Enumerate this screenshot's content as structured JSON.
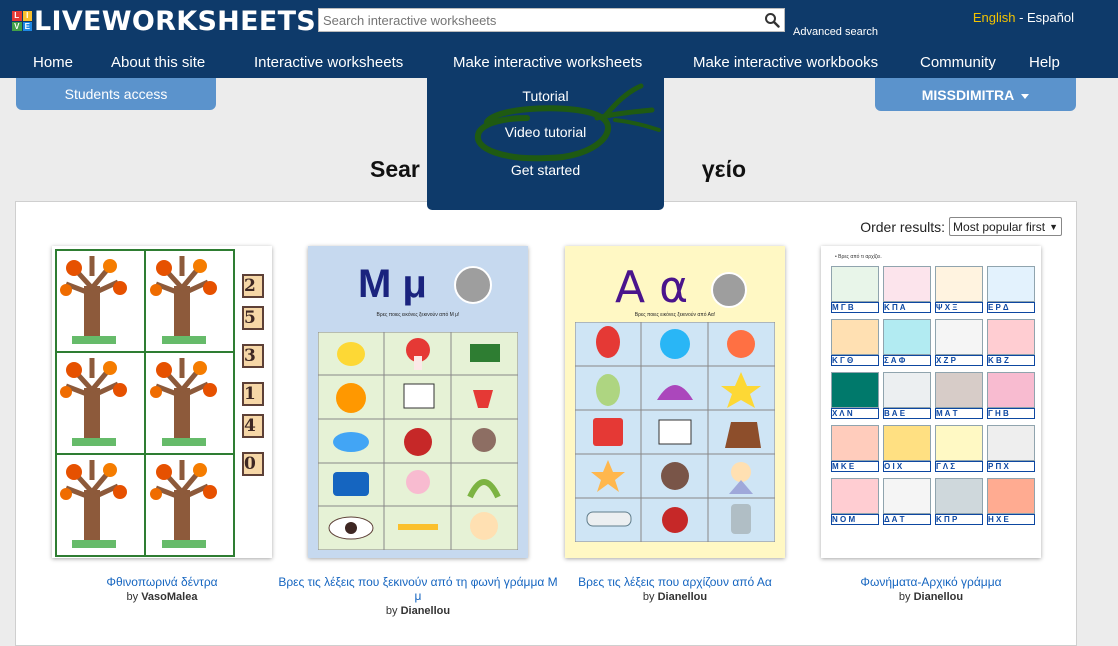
{
  "header": {
    "logo_letters": [
      "L",
      "I",
      "V",
      "E"
    ],
    "logo_text": "LIVEWORKSHEETS",
    "search_placeholder": "Search interactive worksheets",
    "advanced_search": "Advanced search",
    "lang_english": "English",
    "lang_sep": " - ",
    "lang_spanish": "Español"
  },
  "nav": {
    "home": "Home",
    "about": "About this site",
    "interactive": "Interactive worksheets",
    "make": "Make interactive worksheets",
    "workbooks": "Make interactive workbooks",
    "community": "Community",
    "help": "Help"
  },
  "students_access": "Students access",
  "user_menu": "MISSDIMITRA",
  "heading_left": "Sear",
  "heading_right": "γείο",
  "dropdown": {
    "items": [
      "Tutorial",
      "Video tutorial",
      "Get started"
    ]
  },
  "results": {
    "order_label": "Order results:",
    "order_value": "Most popular first",
    "cards": [
      {
        "title": "Φθινοπωρινά δέντρα",
        "by": "by",
        "author": "VasoMalea"
      },
      {
        "title": "Βρες τις λέξεις που ξεκινούν από τη φωνή γράμμα Μ μ",
        "by": "by",
        "author": "Dianellou"
      },
      {
        "title": "Βρες τις λέξεις που αρχίζουν από Αα",
        "by": "by",
        "author": "Dianellou"
      },
      {
        "title": "Φωνήματα-Αρχικό γράμμα",
        "by": "by",
        "author": "Dianellou"
      }
    ]
  },
  "thumb2": {
    "big": "Μ μ",
    "sub": "Βρες ποιες εικόνες ξεκινούν από Μ μ!"
  },
  "thumb3": {
    "big": "Α α",
    "sub": "Βρες ποιες εικόνες ξεκινούν από Αα!"
  },
  "thumb1": {
    "numbers": [
      "2",
      "5",
      "3",
      "1",
      "4",
      "0"
    ]
  },
  "thumb4": {
    "rows": [
      [
        "Μ Γ Β",
        "Κ Π Α",
        "Ψ Χ Ξ",
        "Ε Ρ Δ"
      ],
      [
        "Κ Γ Θ",
        "Σ Α Φ",
        "Χ Ζ Ρ",
        "Κ Β Ζ"
      ],
      [
        "Χ Λ Ν",
        "Β Α Ε",
        "Μ Α Τ",
        "Γ Η Β"
      ],
      [
        "Μ Κ Ε",
        "Ο Ι Χ",
        "Γ Λ Σ",
        "Ρ Π Χ"
      ],
      [
        "Ν Ο Μ",
        "Δ Α Τ",
        "Κ Π Ρ",
        "Η Χ Ε"
      ]
    ],
    "intro": "• Βρες από τι αρχίζει."
  },
  "colors": {
    "header_bg": "#0e3a6a",
    "button_bg": "#5b93cc",
    "link": "#1565c0",
    "annotation": "#1f5a12"
  }
}
